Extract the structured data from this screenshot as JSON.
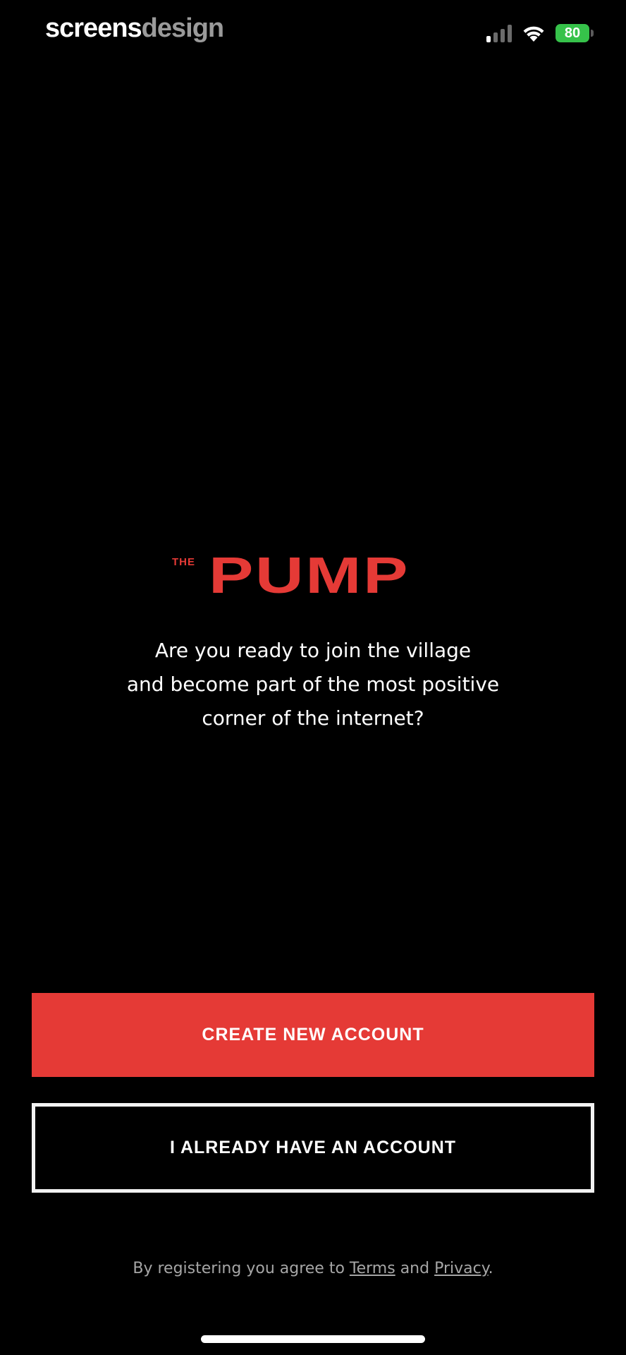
{
  "watermark": {
    "part_a": "screens",
    "part_b": "design"
  },
  "status_bar": {
    "signal_icon": "cellular-signal-icon",
    "wifi_icon": "wifi-icon",
    "battery_level": "80",
    "battery_color": "#36c24a",
    "battery_charging": true
  },
  "logo": {
    "prefix": "THE",
    "name": "PUMP",
    "color": "#e53a36"
  },
  "tagline": {
    "lines": [
      "Are you ready to join the village",
      "and become part of the most positive",
      "corner of the internet?"
    ]
  },
  "buttons": {
    "create_account": "CREATE NEW ACCOUNT",
    "login": "I ALREADY HAVE AN ACCOUNT"
  },
  "legal": {
    "prefix": "By registering you agree to ",
    "terms_link": "Terms",
    "middle": " and ",
    "privacy_link": "Privacy",
    "suffix": "."
  },
  "colors": {
    "accent": "#e53a36",
    "background": "#000000",
    "text": "#ffffff",
    "muted_text": "#a6a6a6"
  }
}
